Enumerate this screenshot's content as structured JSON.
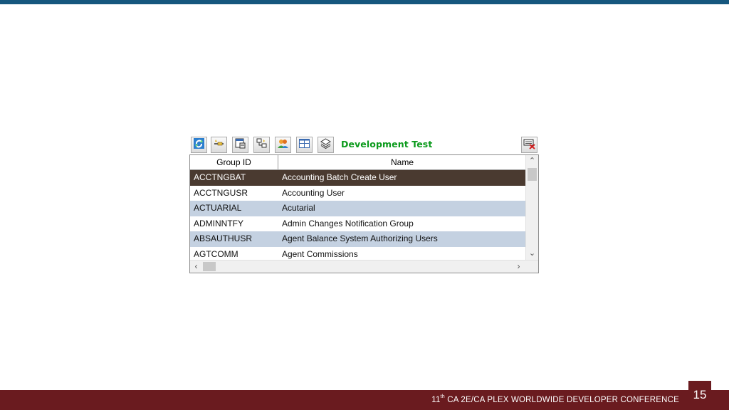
{
  "toolbar": {
    "buttons": [
      {
        "icon": "refresh-icon"
      },
      {
        "icon": "wand-line-icon"
      },
      {
        "icon": "window-list-icon"
      },
      {
        "icon": "tree-nodes-icon"
      },
      {
        "icon": "users-group-icon"
      },
      {
        "icon": "grid-layout-icon"
      },
      {
        "icon": "stack-layers-icon"
      }
    ],
    "environment_title": "Development Test",
    "close_icon": "keyboard-delete-icon"
  },
  "grid": {
    "columns": [
      "Group ID",
      "Name"
    ],
    "rows": [
      {
        "id": "ACCTNGBAT",
        "name": "Accounting Batch Create User",
        "state": "selected"
      },
      {
        "id": "ACCTNGUSR",
        "name": "Accounting User",
        "state": "normal"
      },
      {
        "id": "ACTUARIAL",
        "name": "Acutarial",
        "state": "alt"
      },
      {
        "id": "ADMINNTFY",
        "name": "Admin Changes Notification Group",
        "state": "normal"
      },
      {
        "id": "ABSAUTHUSR",
        "name": "Agent Balance System Authorizing Users",
        "state": "alt"
      },
      {
        "id": "AGTCOMM",
        "name": "Agent Commissions",
        "state": "normal"
      }
    ]
  },
  "footer": {
    "conference_num": "11",
    "conference_sup": "th",
    "conference_rest": " CA 2E/CA PLEX WORLDWIDE DEVELOPER CONFERENCE",
    "page_number": "15"
  },
  "colors": {
    "top_band": "#16577e",
    "footer_bg": "#6a1b1f",
    "selected_row": "#4a3a30",
    "alt_row": "#c4d1e1",
    "environment_title": "#0a9a1b"
  }
}
